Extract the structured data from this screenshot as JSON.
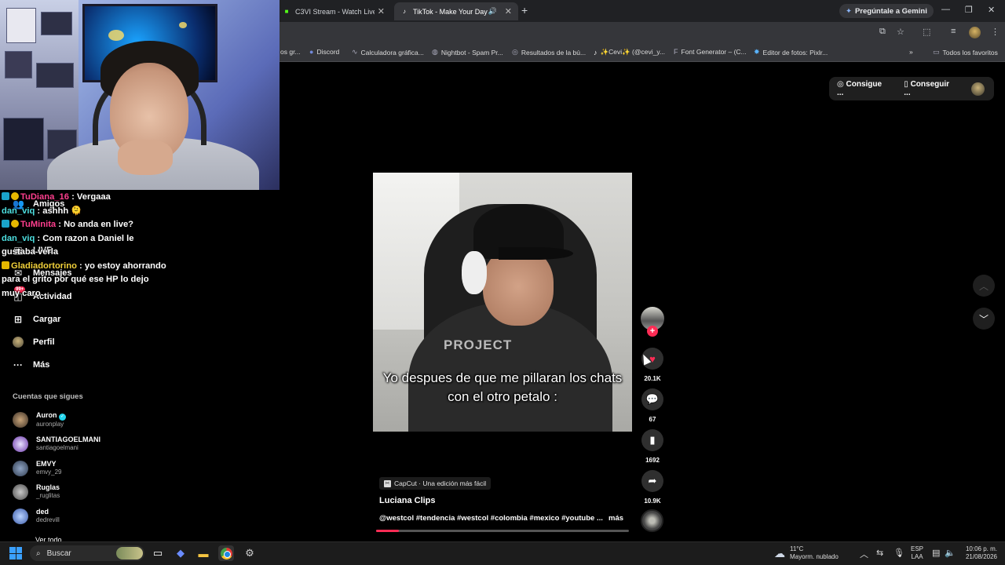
{
  "browser": {
    "tabs": [
      {
        "label": "C3VI Stream - Watch Live on Ki",
        "icon": "kick-icon"
      },
      {
        "label": "TikTok - Make Your Day",
        "icon": "tiktok-icon"
      }
    ],
    "gemini_label": "Pregúntale a Gemini",
    "bookmarks": [
      {
        "label": "os gr..."
      },
      {
        "label": "Discord"
      },
      {
        "label": "Calculadora gráfica..."
      },
      {
        "label": "Nightbot - Spam Pr..."
      },
      {
        "label": "Resultados de la bú..."
      },
      {
        "label": "✨Cevi✨ (@cevi_y..."
      },
      {
        "label": "Font Generator – (C..."
      },
      {
        "label": "Editor de fotos: Pixlr..."
      }
    ],
    "all_bookmarks": "Todos los favoritos"
  },
  "chat": [
    {
      "user": "TuDiana_16",
      "text": " : Vergaaa",
      "color": "u1"
    },
    {
      "user": "dan_viq",
      "text": " : ashhh 🫠",
      "color": "u2"
    },
    {
      "user": "TuMinita",
      "text": " : No anda en live?",
      "color": "u1"
    },
    {
      "user": "dan_viq",
      "text": " : Com razon a Daniel le gustaba verla",
      "color": "u2"
    },
    {
      "user": "Gladiadortorino",
      "text": " : yo estoy ahorrando para el grito por qué ese HP lo dejo muy caro",
      "color": "u3"
    }
  ],
  "sidebar": {
    "items": [
      {
        "label": "Amigos",
        "icon": "friends-icon"
      },
      {
        "label": "LIVE",
        "icon": "live-icon"
      },
      {
        "label": "Mensajes",
        "icon": "messages-icon"
      },
      {
        "label": "Actividad",
        "icon": "activity-icon",
        "badge": "99+"
      },
      {
        "label": "Cargar",
        "icon": "upload-icon"
      },
      {
        "label": "Perfil",
        "icon": "profile-icon"
      },
      {
        "label": "Más",
        "icon": "more-icon"
      }
    ],
    "following_title": "Cuentas que sigues",
    "accounts": [
      {
        "name": "Auron",
        "handle": "auronplay",
        "verified": true
      },
      {
        "name": "SANTIAGOELMANI",
        "handle": "santiagoelmani"
      },
      {
        "name": "EMVY",
        "handle": "emvy_29"
      },
      {
        "name": "Ruglas",
        "handle": "_ruglitas"
      },
      {
        "name": "ded",
        "handle": "dedrevill"
      }
    ],
    "see_all": "Ver todo"
  },
  "top_pills": {
    "coins": "Consigue ...",
    "app": "Conseguir ..."
  },
  "video": {
    "caption": "Yo despues de que me pillaran los chats con el otro petalo :",
    "shirt_text": "PROJECT",
    "capcut_label": "CapCut · Una edición más fácil",
    "author": "Luciana Clips",
    "hashtags": "@westcol #tendencia #westcol #colombia #mexico #youtube ...",
    "more": "más",
    "progress": 0.09
  },
  "actions": {
    "likes": "20.1K",
    "comments": "67",
    "saves": "1692",
    "shares": "10.9K"
  },
  "taskbar": {
    "search": "Buscar",
    "weather_temp": "11°C",
    "weather_desc": "Mayorm. nublado",
    "lang1": "ESP",
    "lang2": "LAA",
    "time": "10:06 p. m.",
    "date": "21/08/2026"
  }
}
